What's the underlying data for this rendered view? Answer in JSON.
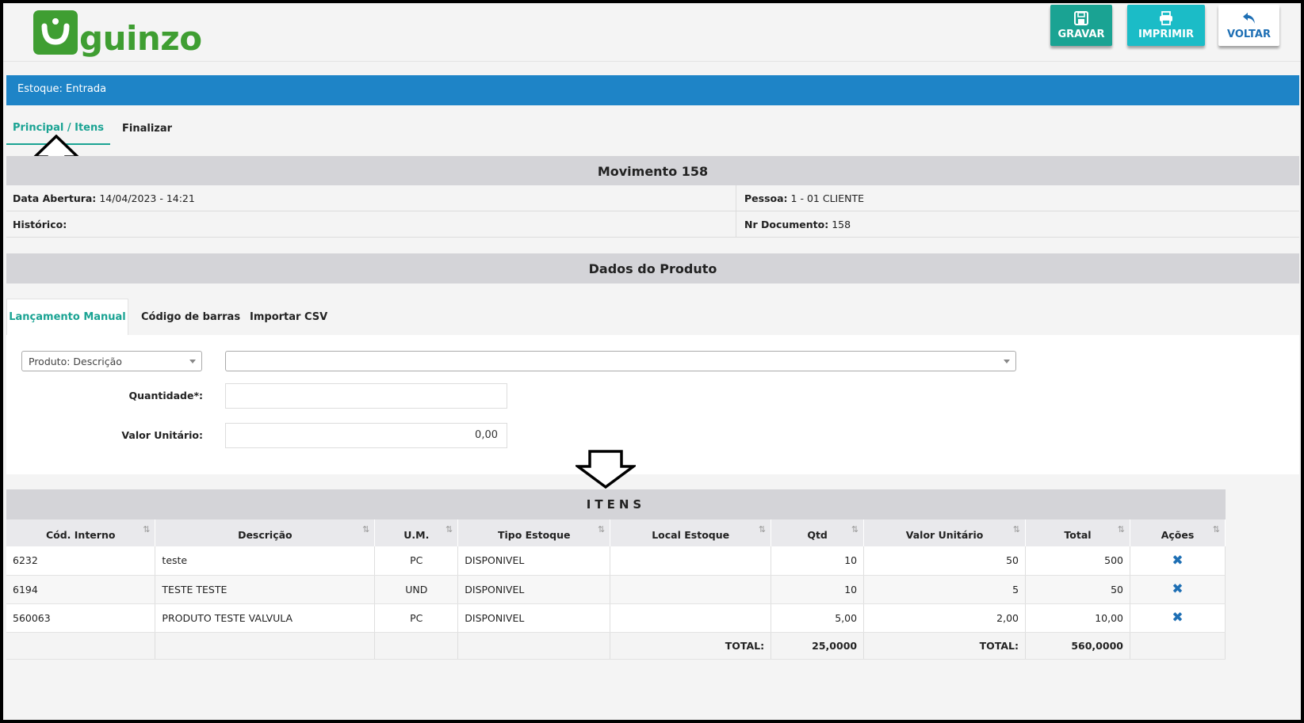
{
  "header": {
    "logo_text": "guinzo",
    "buttons": {
      "save": "GRAVAR",
      "print": "IMPRIMIR",
      "back": "VOLTAR"
    }
  },
  "title_bar": "Estoque: Entrada",
  "main_tabs": [
    "Principal / Itens",
    "Finalizar"
  ],
  "movement": {
    "title": "Movimento 158",
    "open_date_label": "Data Abertura:",
    "open_date": "14/04/2023 - 14:21",
    "history_label": "Histórico:",
    "history": "",
    "person_label": "Pessoa:",
    "person": "1 - 01 CLIENTE",
    "doc_label": "Nr Documento:",
    "doc": "158"
  },
  "product": {
    "title": "Dados do Produto",
    "tabs": [
      "Lançamento Manual",
      "Código de barras",
      "Importar CSV"
    ],
    "search_type": "Produto: Descrição",
    "product_value": "",
    "quantity_label": "Quantidade*:",
    "quantity_value": "",
    "unit_value_label": "Valor Unitário:",
    "unit_value": "0,00"
  },
  "items": {
    "title": "ITENS",
    "columns": [
      "Cód. Interno",
      "Descrição",
      "U.M.",
      "Tipo Estoque",
      "Local Estoque",
      "Qtd",
      "Valor Unitário",
      "Total",
      "Ações"
    ],
    "rows": [
      {
        "code": "6232",
        "desc": "teste",
        "um": "PC",
        "type": "DISPONIVEL",
        "local": "",
        "qty": "10",
        "unit": "50",
        "total": "500"
      },
      {
        "code": "6194",
        "desc": "TESTE TESTE",
        "um": "UND",
        "type": "DISPONIVEL",
        "local": "",
        "qty": "10",
        "unit": "5",
        "total": "50"
      },
      {
        "code": "560063",
        "desc": "PRODUTO TESTE VALVULA",
        "um": "PC",
        "type": "DISPONIVEL",
        "local": "",
        "qty": "5,00",
        "unit": "2,00",
        "total": "10,00"
      }
    ],
    "total_label_1": "TOTAL:",
    "total_qty": "25,0000",
    "total_label_2": "TOTAL:",
    "total_value": "560,0000"
  },
  "colors": {
    "brand_green": "#3f9e32",
    "teal": "#1aa393",
    "cyan": "#1bbcc7",
    "title_blue": "#1e84c7"
  }
}
